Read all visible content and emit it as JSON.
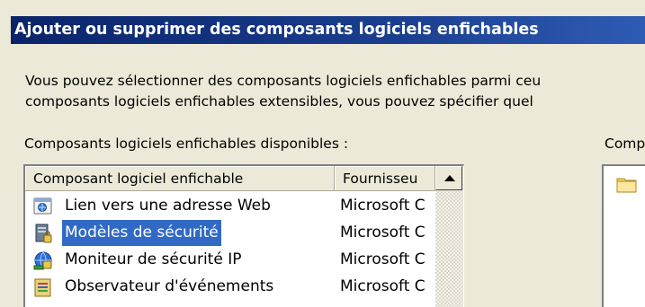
{
  "dialog": {
    "title": "Ajouter ou supprimer des composants logiciels enfichables",
    "description_line1": "Vous pouvez sélectionner des composants logiciels enfichables parmi ceu",
    "description_line2": "composants logiciels enfichables extensibles, vous pouvez spécifier quel"
  },
  "available": {
    "label": "Composants logiciels enfichables disponibles :",
    "columns": [
      "Composant logiciel enfichable",
      "Fournisseu"
    ],
    "rows": [
      {
        "name": "Lien vers une adresse Web",
        "provider": "Microsoft C",
        "icon": "web-link-icon",
        "selected": false
      },
      {
        "name": "Modèles de sécurité",
        "provider": "Microsoft C",
        "icon": "security-templates-icon",
        "selected": true
      },
      {
        "name": "Moniteur de sécurité IP",
        "provider": "Microsoft C",
        "icon": "ip-security-monitor-icon",
        "selected": false
      },
      {
        "name": "Observateur d'événements",
        "provider": "Microsoft C",
        "icon": "event-viewer-icon",
        "selected": false
      }
    ]
  },
  "selected_panel": {
    "label": "Comp"
  },
  "colors": {
    "titlebar": "#0a246a",
    "selection": "#316ac5",
    "background": "#ece9d8"
  }
}
